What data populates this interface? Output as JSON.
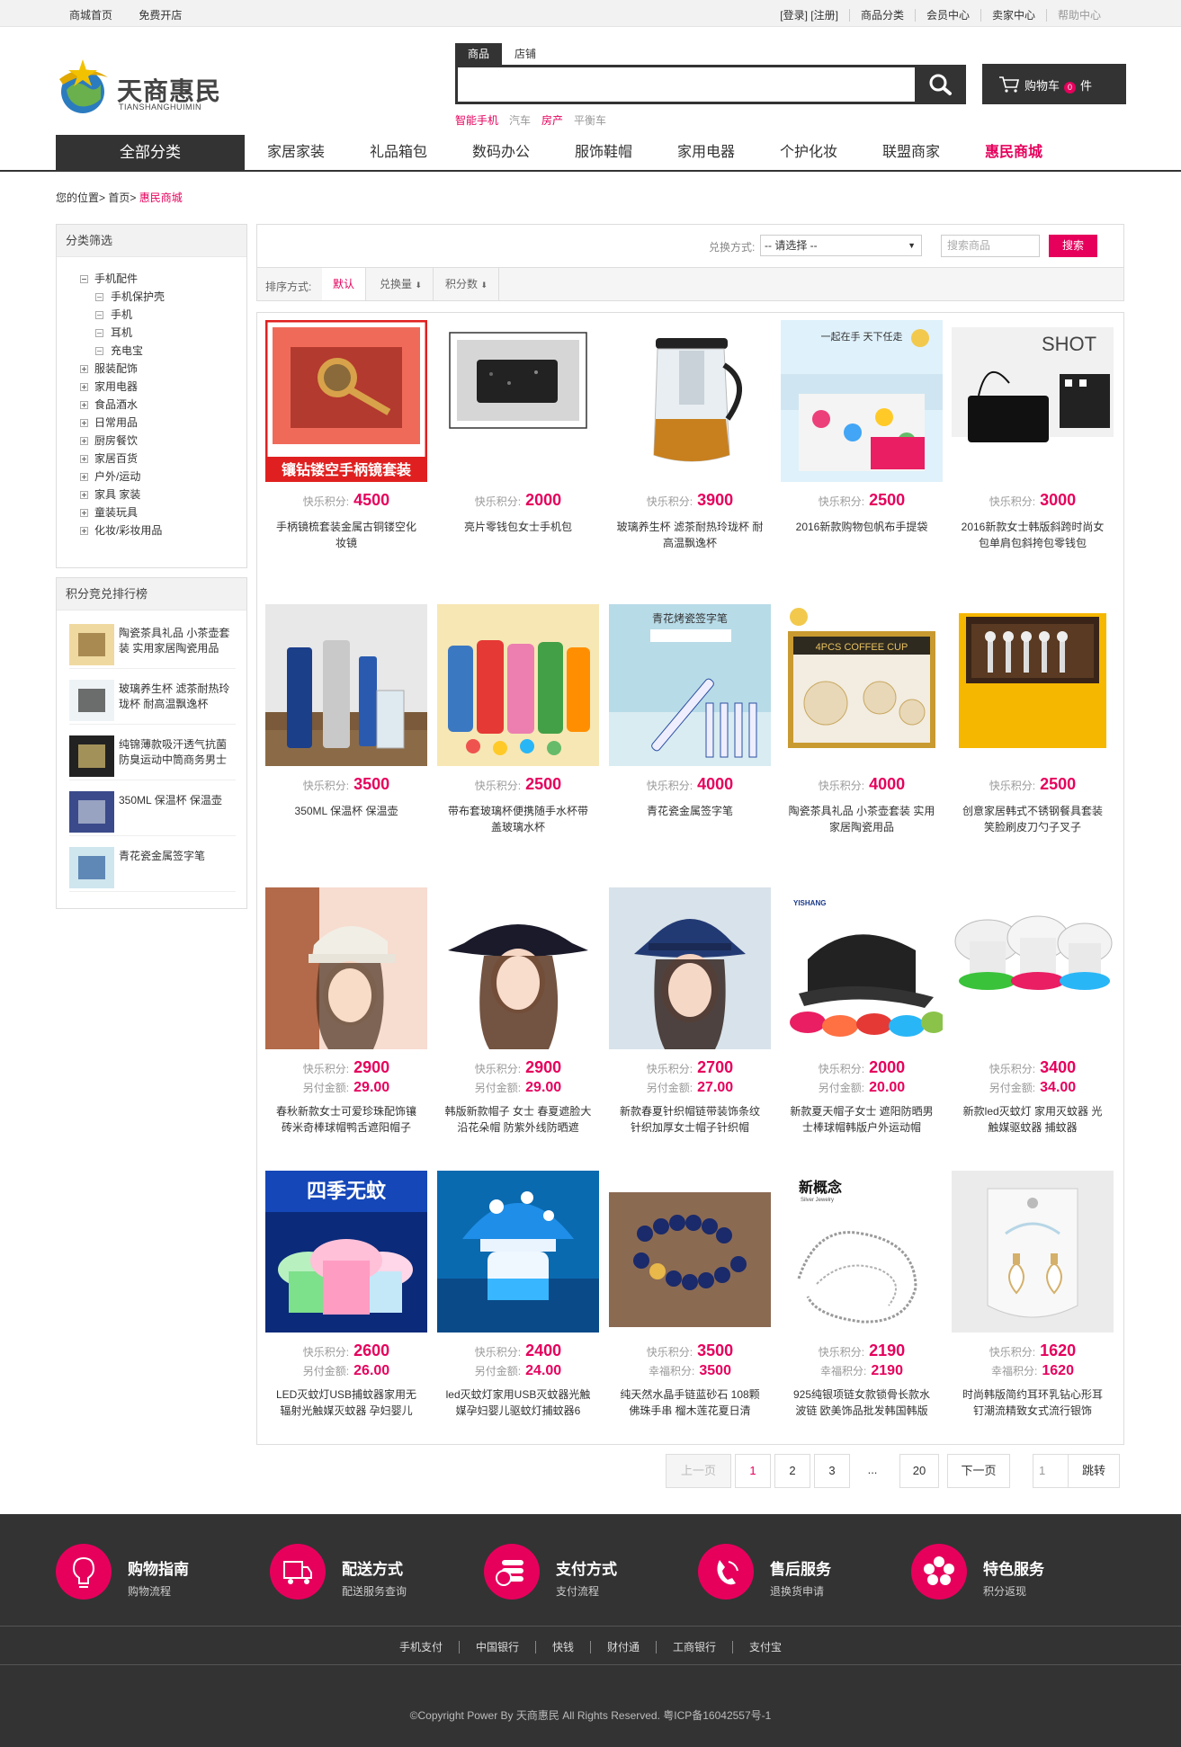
{
  "topbar": {
    "left": [
      "商城首页",
      "免费开店"
    ],
    "right": [
      "[登录] [注册]",
      "商品分类",
      "会员中心",
      "卖家中心",
      "帮助中心"
    ]
  },
  "logo": {
    "cn": "天商惠民",
    "en": "TIANSHANGHUIMIN"
  },
  "search": {
    "tabs": [
      "商品",
      "店铺"
    ],
    "placeholder": ""
  },
  "hot_words": [
    "智能手机",
    "汽车",
    "房产",
    "平衡车"
  ],
  "cart": {
    "label": "购物车",
    "count": "0",
    "unit": "件"
  },
  "nav": {
    "all": "全部分类",
    "items": [
      "家居家装",
      "礼品箱包",
      "数码办公",
      "服饰鞋帽",
      "家用电器",
      "个护化妆",
      "联盟商家",
      "惠民商城"
    ]
  },
  "breadcrumb": {
    "prefix": "您的位置>",
    "home": "首页>",
    "current": "惠民商城"
  },
  "category": {
    "title": "分类筛选",
    "items": [
      {
        "label": "手机配件",
        "level": 0,
        "open": true
      },
      {
        "label": "手机保护壳",
        "level": 1
      },
      {
        "label": "手机",
        "level": 1
      },
      {
        "label": "耳机",
        "level": 1
      },
      {
        "label": "充电宝",
        "level": 1
      },
      {
        "label": "服装配饰",
        "level": 0
      },
      {
        "label": "家用电器",
        "level": 0
      },
      {
        "label": "食品酒水",
        "level": 0
      },
      {
        "label": "日常用品",
        "level": 0
      },
      {
        "label": "厨房餐饮",
        "level": 0
      },
      {
        "label": "家居百货",
        "level": 0
      },
      {
        "label": "户外/运动",
        "level": 0
      },
      {
        "label": "家具 家装",
        "level": 0
      },
      {
        "label": "童装玩具",
        "level": 0
      },
      {
        "label": "化妆/彩妆用品",
        "level": 0
      }
    ]
  },
  "ranking": {
    "title": "积分竞兑排行榜",
    "items": [
      "陶瓷茶具礼品 小茶壶套装 实用家居陶瓷用品",
      "玻璃养生杯 滤茶耐热玲珑杯 耐高温飘逸杯",
      "纯锦薄款吸汗透气抗菌防臭运动中筒商务男士",
      "350ML 保温杯 保温壶",
      "青花瓷金属签字笔"
    ]
  },
  "filter": {
    "label": "兑换方式:",
    "select": "-- 请选择 --",
    "keyword_placeholder": "搜索商品",
    "button": "搜索"
  },
  "sort": {
    "label": "排序方式:",
    "options": [
      "默认",
      "兑换量",
      "积分数"
    ]
  },
  "products": [
    {
      "name": "手柄镜梳套装金属古铜镂空化妆镜",
      "l1": "快乐积分:",
      "v1": "4500",
      "img": "mirror",
      "caption": "镶钻镂空手柄镜套装"
    },
    {
      "name": "亮片零钱包女士手机包",
      "l1": "快乐积分:",
      "v1": "2000",
      "img": "purse"
    },
    {
      "name": "玻璃养生杯 滤茶耐热玲珑杯 耐高温飘逸杯",
      "l1": "快乐积分:",
      "v1": "3900",
      "img": "teapot"
    },
    {
      "name": "2016新款购物包帆布手提袋",
      "l1": "快乐积分:",
      "v1": "2500",
      "img": "bag",
      "caption": "一起在手 天下任走"
    },
    {
      "name": "2016新款女士韩版斜跨时尚女包单肩包斜挎包零钱包",
      "l1": "快乐积分:",
      "v1": "3000",
      "img": "shot",
      "caption": "SHOT"
    },
    {
      "name": "350ML 保温杯 保温壶",
      "l1": "快乐积分:",
      "v1": "3500",
      "img": "flask"
    },
    {
      "name": "带布套玻璃杯便携随手水杯带盖玻璃水杯",
      "l1": "快乐积分:",
      "v1": "2500",
      "img": "bottles"
    },
    {
      "name": "青花瓷金属签字笔",
      "l1": "快乐积分:",
      "v1": "4000",
      "img": "pen",
      "caption": "青花烤瓷签字笔"
    },
    {
      "name": "陶瓷茶具礼品 小茶壶套装 实用家居陶瓷用品",
      "l1": "快乐积分:",
      "v1": "4000",
      "img": "teaset",
      "caption": "4PCS COFFEE CUP"
    },
    {
      "name": "创意家居韩式不锈钢餐具套装 笑脸刷皮刀勺子叉子",
      "l1": "快乐积分:",
      "v1": "2500",
      "img": "cutlery"
    },
    {
      "name": "春秋新款女士可爱珍珠配饰镶砖米奇棒球帽鸭舌遮阳帽子",
      "l1": "快乐积分:",
      "v1": "2900",
      "l2": "另付金额:",
      "v2": "29.00",
      "img": "hat1"
    },
    {
      "name": "韩版新款帽子 女士 春夏遮脸大沿花朵帽 防紫外线防晒遮",
      "l1": "快乐积分:",
      "v1": "2900",
      "l2": "另付金额:",
      "v2": "29.00",
      "img": "hat2"
    },
    {
      "name": "新款春夏针织帽链带装饰条纹针织加厚女士帽子针织帽",
      "l1": "快乐积分:",
      "v1": "2700",
      "l2": "另付金额:",
      "v2": "27.00",
      "img": "hat3"
    },
    {
      "name": "新款夏天帽子女士 遮阳防晒男士棒球帽韩版户外运动帽",
      "l1": "快乐积分:",
      "v1": "2000",
      "l2": "另付金额:",
      "v2": "20.00",
      "img": "caps",
      "caption": "YISHANG"
    },
    {
      "name": "新款led灭蚊灯 家用灭蚊器 光触媒驱蚊器 捕蚊器",
      "l1": "快乐积分:",
      "v1": "3400",
      "l2": "另付金额:",
      "v2": "34.00",
      "img": "lamps"
    },
    {
      "name": "LED灭蚊灯USB捕蚊器家用无辐射光触媒灭蚊器 孕妇婴儿",
      "l1": "快乐积分:",
      "v1": "2600",
      "l2": "另付金额:",
      "v2": "26.00",
      "img": "mosq",
      "caption": "四季无蚊"
    },
    {
      "name": "led灭蚊灯家用USB灭蚊器光触媒孕妇婴儿驱蚊灯捕蚊器6",
      "l1": "快乐积分:",
      "v1": "2400",
      "l2": "另付金额:",
      "v2": "24.00",
      "img": "mush"
    },
    {
      "name": "纯天然水晶手链蓝砂石 108颗佛珠手串 榴木莲花夏日清",
      "l1": "快乐积分:",
      "v1": "3500",
      "l2": "幸福积分:",
      "v2": "3500",
      "img": "beads"
    },
    {
      "name": "925纯银项链女款锁骨长款水波链 欧美饰品批发韩国韩版",
      "l1": "快乐积分:",
      "v1": "2190",
      "l2": "幸福积分:",
      "v2": "2190",
      "img": "chain",
      "caption": "新概念"
    },
    {
      "name": "时尚韩版简约耳环乳钻心形耳钉潮流精致女式流行银饰",
      "l1": "快乐积分:",
      "v1": "1620",
      "l2": "幸福积分:",
      "v2": "1620",
      "img": "earring"
    }
  ],
  "pagination": {
    "prev": "上一页",
    "pages": [
      "1",
      "2",
      "3"
    ],
    "ellipsis": "...",
    "last": "20",
    "next": "下一页",
    "jump_value": "1",
    "jump": "跳转"
  },
  "services": [
    {
      "title": "购物指南",
      "sub": "购物流程",
      "icon": "bulb-icon"
    },
    {
      "title": "配送方式",
      "sub": "配送服务查询",
      "icon": "truck-icon"
    },
    {
      "title": "支付方式",
      "sub": "支付流程",
      "icon": "coins-icon"
    },
    {
      "title": "售后服务",
      "sub": "退换货申请",
      "icon": "phone-icon"
    },
    {
      "title": "特色服务",
      "sub": "积分返现",
      "icon": "flower-icon"
    }
  ],
  "footer_links": [
    "手机支付",
    "中国银行",
    "快钱",
    "财付通",
    "工商银行",
    "支付宝"
  ],
  "copyright": "©Copyright Power By 天商惠民 All Rights Reserved. 粤ICP备16042557号-1",
  "colors": {
    "accent": "#e6005c",
    "dark": "#333333"
  }
}
